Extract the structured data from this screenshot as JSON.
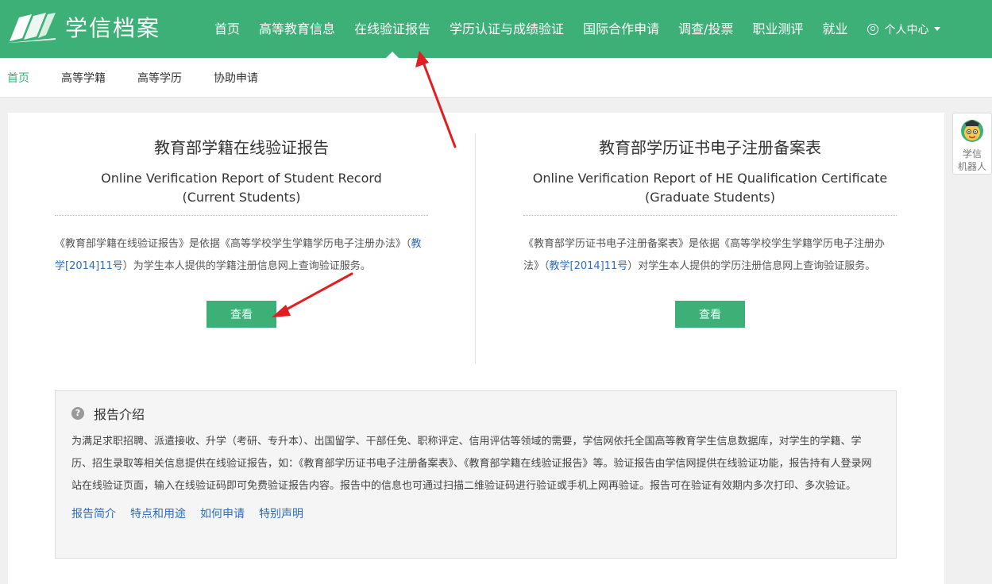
{
  "header": {
    "logo_text": "学信档案",
    "nav": [
      {
        "label": "首页"
      },
      {
        "label": "高等教育信息"
      },
      {
        "label": "在线验证报告"
      },
      {
        "label": "学历认证与成绩验证"
      },
      {
        "label": "国际合作申请"
      },
      {
        "label": "调查/投票"
      },
      {
        "label": "职业测评"
      },
      {
        "label": "就业"
      }
    ],
    "active_nav": "在线验证报告",
    "user_menu": "个人中心"
  },
  "subnav": {
    "items": [
      {
        "label": "首页"
      },
      {
        "label": "高等学籍"
      },
      {
        "label": "高等学历"
      },
      {
        "label": "协助申请"
      }
    ],
    "active": "首页"
  },
  "reports": {
    "student": {
      "title": "教育部学籍在线验证报告",
      "en_line1": "Online Verification Report of Student Record",
      "en_line2": "(Current Students)",
      "desc_before": "《教育部学籍在线验证报告》是依据《高等学校学生学籍学历电子注册办法》（",
      "desc_link": "教学[2014]11号",
      "desc_after": "）为学生本人提供的学籍注册信息网上查询验证服务。",
      "button": "查看"
    },
    "graduate": {
      "title": "教育部学历证书电子注册备案表",
      "en_line1": "Online Verification Report of HE Qualification Certificate",
      "en_line2": "(Graduate Students)",
      "desc_before": "《教育部学历证书电子注册备案表》是依据《高等学校学生学籍学历电子注册办法》（",
      "desc_link": "教学[2014]11号",
      "desc_after": "）对学生本人提供的学历注册信息网上查询验证服务。",
      "button": "查看"
    }
  },
  "intro": {
    "title": "报告介绍",
    "body": "为满足求职招聘、派遣接收、升学（考研、专升本）、出国留学、干部任免、职称评定、信用评估等领域的需要，学信网依托全国高等教育学生信息数据库，对学生的学籍、学历、招生录取等相关信息提供在线验证报告，如：《教育部学历证书电子注册备案表》、《教育部学籍在线验证报告》等。验证报告由学信网提供在线验证功能，报告持有人登录网站在线验证页面，输入在线验证码即可免费验证报告内容。报告中的信息也可通过扫描二维验证码进行验证或手机上网再验证。报告可在验证有效期内多次打印、多次验证。",
    "links": [
      {
        "label": "报告简介"
      },
      {
        "label": "特点和用途"
      },
      {
        "label": "如何申请"
      },
      {
        "label": "特别声明"
      }
    ]
  },
  "robot": {
    "label_line1": "学信",
    "label_line2": "机器人"
  },
  "colors": {
    "brand_green": "#3db078",
    "link_blue": "#2f6dba",
    "annotation_red": "#e02020"
  }
}
